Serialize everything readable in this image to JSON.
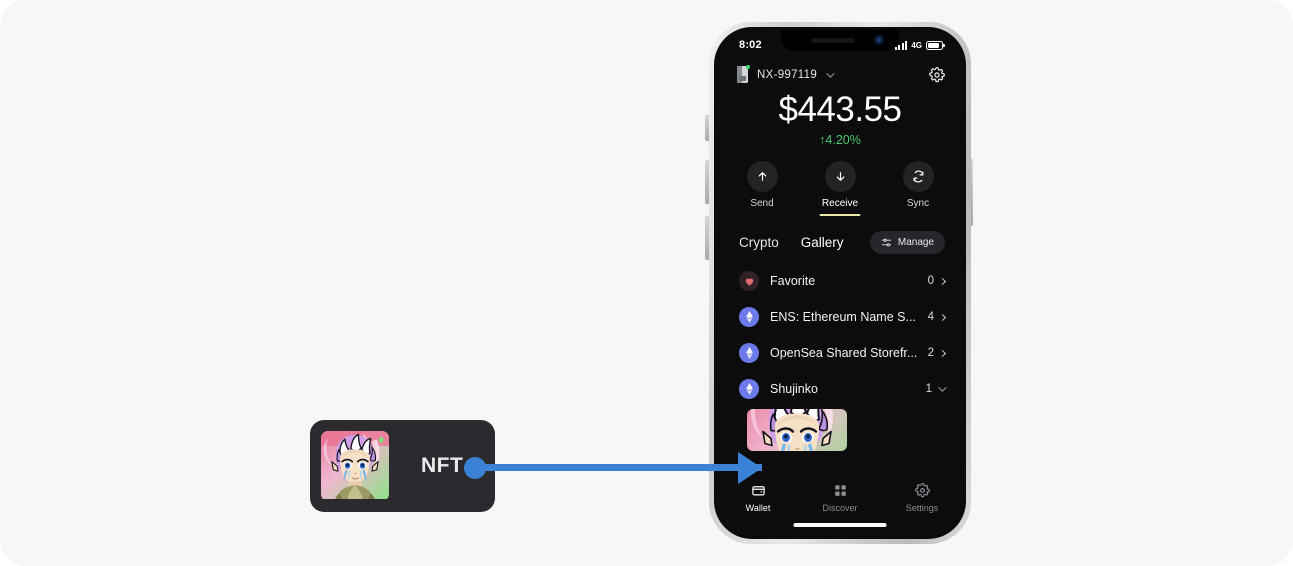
{
  "callout": {
    "label": "NFT",
    "thumb_icon": "nft-artwork-thumbnail",
    "connector_color": "#3b82d6",
    "card_bg": "#2b2b2f"
  },
  "phone": {
    "status_bar": {
      "time": "8:02",
      "signal_icon": "signal-bars-icon",
      "network": "4G",
      "battery_icon": "battery-icon"
    },
    "header": {
      "device_icon": "hardware-wallet-icon",
      "wallet_id": "NX-997119",
      "dropdown_icon": "chevron-down-icon",
      "settings_icon": "gear-icon"
    },
    "balance": {
      "amount": "$443.55",
      "change": "↑4.20%",
      "change_color": "#4ac76a"
    },
    "actions": [
      {
        "label": "Send",
        "icon": "arrow-up-icon",
        "active": false
      },
      {
        "label": "Receive",
        "icon": "arrow-down-icon",
        "active": true
      },
      {
        "label": "Sync",
        "icon": "refresh-icon",
        "active": false
      }
    ],
    "tabs": [
      {
        "label": "Crypto",
        "active": false
      },
      {
        "label": "Gallery",
        "active": true
      }
    ],
    "manage_button": {
      "label": "Manage",
      "icon": "sliders-icon"
    },
    "list": [
      {
        "name": "Favorite",
        "count": "0",
        "icon": "heart-icon",
        "chevron": "chevron-right-icon"
      },
      {
        "name": "ENS: Ethereum Name S...",
        "count": "4",
        "icon": "ethereum-icon",
        "chevron": "chevron-right-icon"
      },
      {
        "name": "OpenSea Shared Storefr...",
        "count": "2",
        "icon": "ethereum-icon",
        "chevron": "chevron-right-icon"
      },
      {
        "name": "Shujinko",
        "count": "1",
        "icon": "ethereum-icon",
        "chevron": "chevron-down-icon"
      }
    ],
    "nft_item": {
      "icon": "nft-artwork-thumbnail"
    },
    "bottom_nav": [
      {
        "label": "Wallet",
        "icon": "wallet-icon",
        "active": true
      },
      {
        "label": "Discover",
        "icon": "grid-icon",
        "active": false
      },
      {
        "label": "Settings",
        "icon": "gear-icon",
        "active": false
      }
    ]
  }
}
